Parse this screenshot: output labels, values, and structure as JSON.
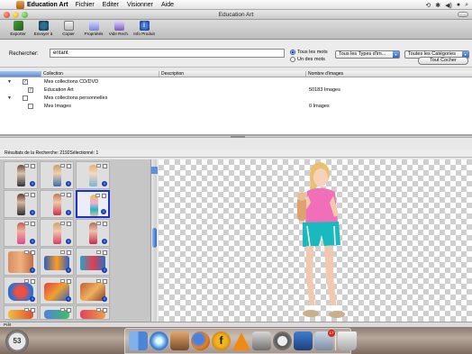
{
  "menubar": {
    "apple_glyph": "",
    "app_name": "Education Art",
    "items": [
      "Fichier",
      "Editer",
      "Visionner",
      "Aide"
    ]
  },
  "window": {
    "title": "Education Art"
  },
  "toolbar": {
    "buttons": [
      {
        "label": "Exporter",
        "icon": "export-icon"
      },
      {
        "label": "Envoyer à",
        "icon": "send-mail-icon"
      },
      {
        "label": "Copier",
        "icon": "copy-icon"
      },
      {
        "label": "Propriétés",
        "icon": "properties-icon"
      },
      {
        "label": "Vide Rech.",
        "icon": "clear-search-icon"
      },
      {
        "label": "Info Produit",
        "icon": "info-icon"
      }
    ]
  },
  "search": {
    "label": "Rechercher:",
    "value": "enfant",
    "radio_all": "Tous les mots",
    "radio_any": "Un des mots",
    "type_popup": "Tous les Types d'im...",
    "category_popup": "Toutes les Catégories",
    "reset_button": "Tout Cocher"
  },
  "collections": {
    "headers": [
      "",
      "Collection",
      "Description",
      "Nombre d'images"
    ],
    "rows": [
      {
        "name": "Mes collections CD/DVD",
        "count": "",
        "checked": true,
        "level": 0,
        "expanded": true
      },
      {
        "name": "Education Art",
        "count": "50183 Images",
        "checked": true,
        "level": 1
      },
      {
        "name": "Mes collections personnelles",
        "count": "",
        "checked": false,
        "level": 0,
        "expanded": true
      },
      {
        "name": "Mes Images",
        "count": "0 Images",
        "checked": false,
        "level": 1
      }
    ]
  },
  "results": {
    "text": "Résultats de la Recherche: 2192Sélectionné: 1"
  },
  "status": {
    "text": "Prêt"
  },
  "clock": {
    "label": "53"
  },
  "dock": {
    "firefox_letter": "f",
    "mail_badge": "17"
  },
  "colors": {
    "selection_border": "#1c2fd0",
    "accent_blue": "#2f66c6",
    "dress_pink": "#f06fb8",
    "shorts_teal": "#19b9c0"
  }
}
